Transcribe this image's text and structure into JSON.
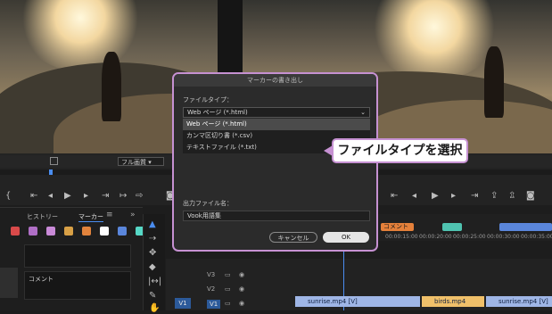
{
  "program_monitor_left": {
    "zoom_select": "フル画質",
    "zoom_fit": "フル画質"
  },
  "program_monitor_right": {
    "timecodes": [
      "00:00:15:00",
      "00:00:20:00",
      "00:00:25:00",
      "00:00:30:00",
      "00:00:35:00"
    ]
  },
  "left_panel": {
    "tabs": [
      "ヒストリー",
      "マーカー"
    ],
    "menu_icon": "≡",
    "overflow": "»",
    "comment_label": "コメント"
  },
  "label_colors": [
    "#d94a4a",
    "#b06fc6",
    "#c98ad8",
    "#d8a046",
    "#e1833c",
    "#ffffff",
    "#5a86db",
    "#56d8c6"
  ],
  "timeline": {
    "tracks": [
      {
        "name": "V3"
      },
      {
        "name": "V2"
      },
      {
        "name": "V1",
        "source": "V1"
      }
    ],
    "marker_comment": "コメント",
    "clips": [
      {
        "name": "sunrise.mp4 [V]",
        "color": "#9fb6e6"
      },
      {
        "name": "birds.mp4",
        "color": "#f0c06a"
      },
      {
        "name": "sunrise.mp4 [V]",
        "color": "#9fb6e6"
      }
    ]
  },
  "dialog": {
    "title": "マーカーの書き出し",
    "file_type_label": "ファイルタイプ：",
    "selected_value": "Web ページ (*.html)",
    "options": [
      "Web ページ (*.html)",
      "カンマ区切り書 (*.csv)",
      "テキストファイル (*.txt)"
    ],
    "output_name_label": "出力ファイル名：",
    "output_name_value": "Vook用語集",
    "cancel_label": "キャンセル",
    "ok_label": "OK"
  },
  "callout": {
    "text": "ファイルタイプを選択"
  },
  "accent_color": "#c691d2"
}
